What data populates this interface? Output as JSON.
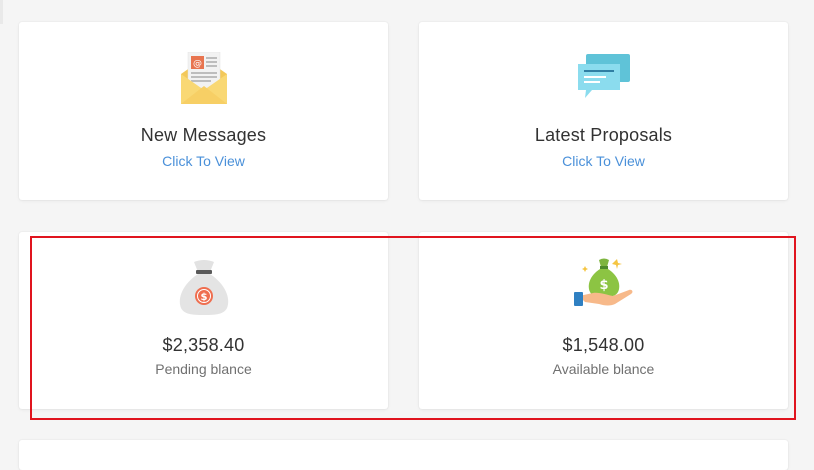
{
  "cards": {
    "messages": {
      "title": "New Messages",
      "link": "Click To View",
      "icon": "envelope-icon"
    },
    "proposals": {
      "title": "Latest Proposals",
      "link": "Click To View",
      "icon": "chat-bubbles-icon"
    },
    "pending": {
      "amount": "$2,358.40",
      "label": "Pending blance",
      "icon": "money-bag-icon"
    },
    "available": {
      "amount": "$1,548.00",
      "label": "Available blance",
      "icon": "hand-money-bag-icon"
    }
  },
  "colors": {
    "link": "#4a90d9",
    "highlight": "#e0141e",
    "background": "#f5f5f5"
  }
}
